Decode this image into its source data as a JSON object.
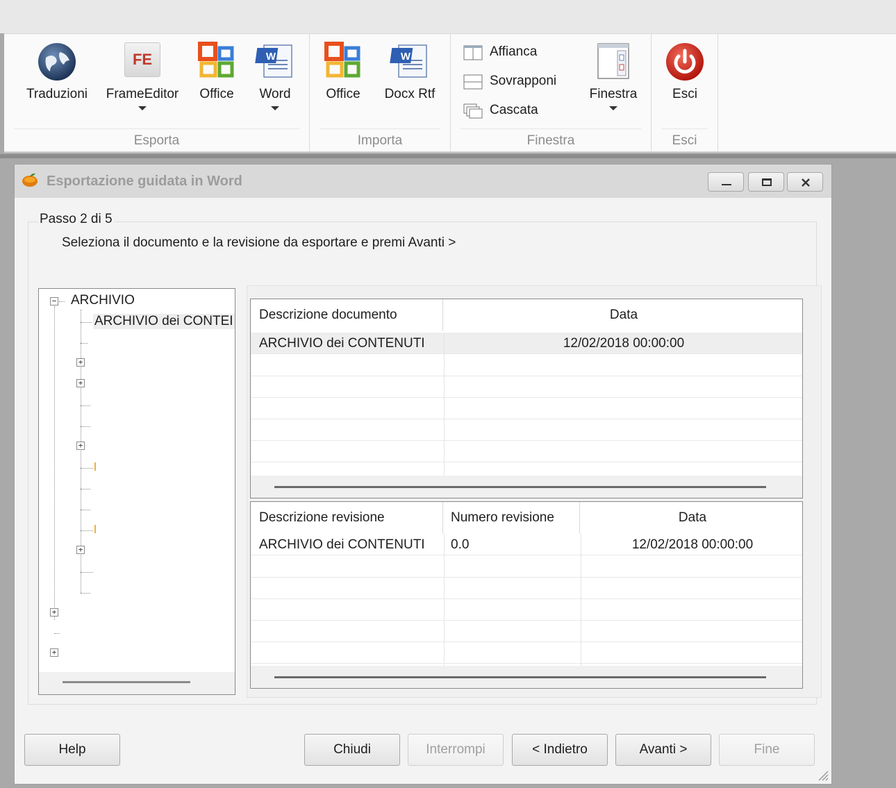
{
  "ribbon": {
    "groups": {
      "esporta": {
        "label": "Esporta",
        "buttons": {
          "traduzioni": "Traduzioni",
          "frameeditor": "FrameEditor",
          "office": "Office",
          "word": "Word"
        }
      },
      "importa": {
        "label": "Importa",
        "buttons": {
          "office": "Office",
          "docx_rtf": "Docx Rtf"
        }
      },
      "finestra": {
        "label": "Finestra",
        "buttons": {
          "affianca": "Affianca",
          "sovrapponi": "Sovrapponi",
          "cascata": "Cascata",
          "finestra": "Finestra"
        }
      },
      "esci": {
        "label": "Esci",
        "buttons": {
          "esci": "Esci"
        }
      }
    },
    "icon_texts": {
      "fe": "FE"
    }
  },
  "window": {
    "title": "Esportazione guidata in Word",
    "step": "Passo 2 di 5",
    "instruction": "Seleziona il documento e la revisione da esportare e premi Avanti >",
    "tree": {
      "root": "ARCHIVIO",
      "child": "ARCHIVIO dei CONTEI"
    },
    "documents_grid": {
      "headers": [
        "Descrizione documento",
        "Data"
      ],
      "rows": [
        {
          "descrizione": "ARCHIVIO dei CONTENUTI",
          "data": "12/02/2018 00:00:00"
        }
      ]
    },
    "revisions_grid": {
      "headers": [
        "Descrizione revisione",
        "Numero revisione",
        "Data"
      ],
      "rows": [
        {
          "descrizione": "ARCHIVIO dei CONTENUTI",
          "numero": "0.0",
          "data": "12/02/2018 00:00:00"
        }
      ]
    },
    "buttons": {
      "help": "Help",
      "chiudi": "Chiudi",
      "interrompi": "Interrompi",
      "indietro": "< Indietro",
      "avanti": "Avanti >",
      "fine": "Fine"
    }
  },
  "colors": {
    "ribbon_bg": "#fafafa",
    "window_bg": "#f3f3f3",
    "workspace_bg": "#a9a9a9",
    "exit_red": "#d9261c",
    "office_orange": "#f07b1e"
  }
}
